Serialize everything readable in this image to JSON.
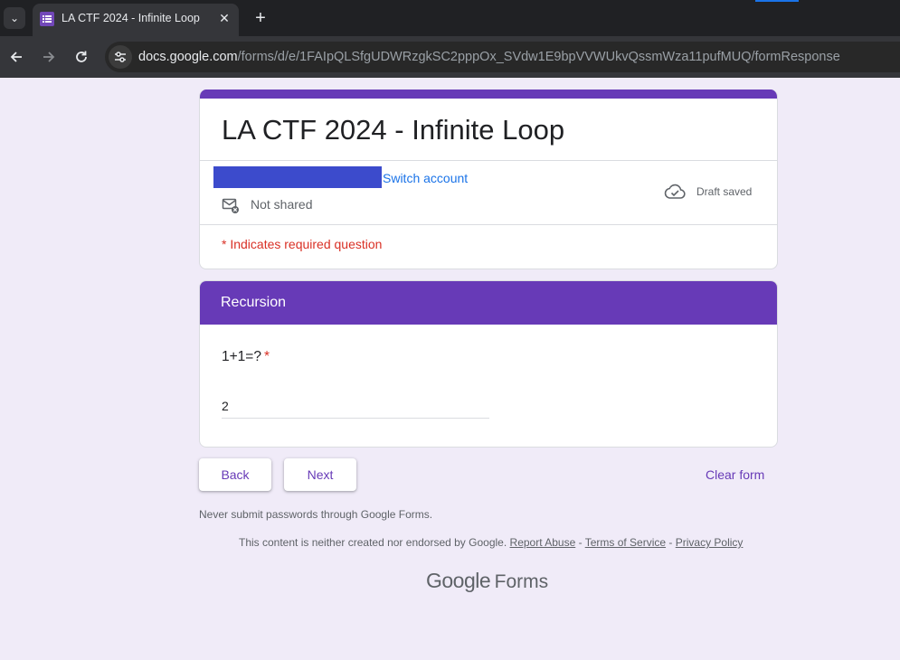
{
  "browser": {
    "tab": {
      "title": "LA CTF 2024 - Infinite Loop"
    },
    "url": {
      "host": "docs.google.com",
      "path": "/forms/d/e/1FAIpQLSfgUDWRzgkSC2pppOx_SVdw1E9bpVVWUkvQssmWza11pufMUQ/formResponse"
    }
  },
  "form": {
    "title": "LA CTF 2024 - Infinite Loop",
    "account": {
      "switch_label": "Switch account",
      "sharing_status": "Not shared",
      "draft_status": "Draft saved"
    },
    "required_note": "* Indicates required question",
    "section": {
      "title": "Recursion",
      "question": {
        "label": "1+1=?",
        "required_mark": "*",
        "answer": "2"
      }
    },
    "buttons": {
      "back": "Back",
      "next": "Next",
      "clear": "Clear form"
    }
  },
  "footer": {
    "warning": "Never submit passwords through Google Forms.",
    "disclaimer": "This content is neither created nor endorsed by Google.",
    "report_abuse": "Report Abuse",
    "terms": "Terms of Service",
    "privacy": "Privacy Policy",
    "separator": " - ",
    "brand_google": "Google",
    "brand_forms": "Forms"
  },
  "colors": {
    "accent": "#673ab7",
    "page_background": "#f0ebf8",
    "required": "#d93025",
    "link": "#1a73e8"
  }
}
